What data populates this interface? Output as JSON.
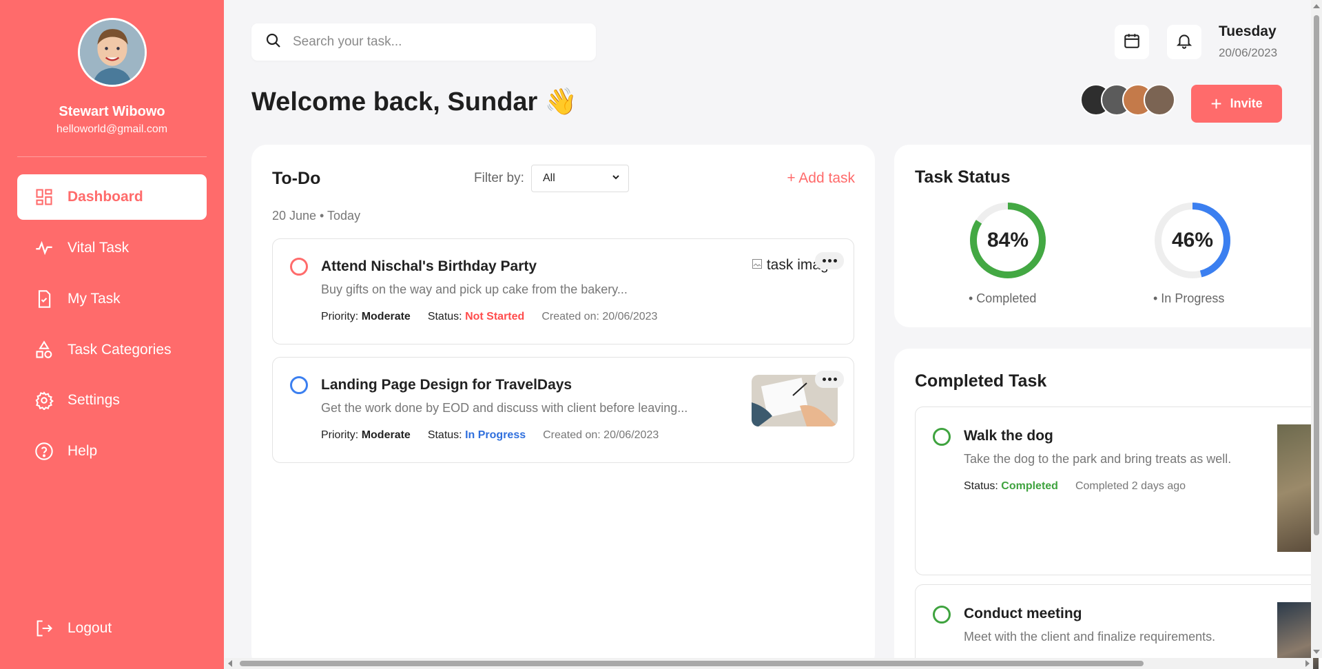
{
  "user": {
    "name": "Stewart Wibowo",
    "email": "helloworld@gmail.com"
  },
  "nav": [
    {
      "label": "Dashboard",
      "icon": "dashboard-icon",
      "active": true
    },
    {
      "label": "Vital Task",
      "icon": "pulse-icon"
    },
    {
      "label": "My Task",
      "icon": "checklist-icon"
    },
    {
      "label": "Task Categories",
      "icon": "categories-icon"
    },
    {
      "label": "Settings",
      "icon": "gear-icon"
    },
    {
      "label": "Help",
      "icon": "help-icon"
    }
  ],
  "logout_label": "Logout",
  "search": {
    "placeholder": "Search your task..."
  },
  "date": {
    "day": "Tuesday",
    "value": "20/06/2023"
  },
  "welcome": "Welcome back, Sundar 👋",
  "invite_label": "Invite",
  "invite_plus": "+",
  "todo": {
    "title": "To-Do",
    "filter_label": "Filter by:",
    "filter_value": "All",
    "add_task": "+ Add task",
    "date_sub": "20 June • Today",
    "tasks": [
      {
        "title": "Attend Nischal's Birthday Party",
        "desc": "Buy gifts on the way and pick up cake from the bakery...",
        "priority_label": "Priority:",
        "priority": "Moderate",
        "status_label": "Status:",
        "status": "Not Started",
        "created": "Created on: 20/06/2023",
        "image_alt": "task image"
      },
      {
        "title": "Landing Page Design for TravelDays",
        "desc": "Get the work done by EOD and discuss with client before leaving...",
        "priority_label": "Priority:",
        "priority": "Moderate",
        "status_label": "Status:",
        "status": "In Progress",
        "created": "Created on: 20/06/2023"
      }
    ]
  },
  "task_status": {
    "title": "Task Status",
    "items": [
      {
        "pct_text": "84%",
        "value": 84,
        "label": "• Completed",
        "color": "#43a843"
      },
      {
        "pct_text": "46%",
        "value": 46,
        "label": "• In Progress",
        "color": "#3b7ff0"
      }
    ]
  },
  "completed": {
    "title": "Completed Task",
    "tasks": [
      {
        "title": "Walk the dog",
        "desc": "Take the dog to the park and bring treats as well.",
        "status_label": "Status:",
        "status": "Completed",
        "when": "Completed 2 days ago"
      },
      {
        "title": "Conduct meeting",
        "desc": "Meet with the client and finalize requirements."
      }
    ]
  },
  "colors": {
    "accent": "#ff6b6b",
    "sidebar": "#ff6b6b",
    "green": "#3fa33f",
    "blue": "#2f6fdd"
  }
}
